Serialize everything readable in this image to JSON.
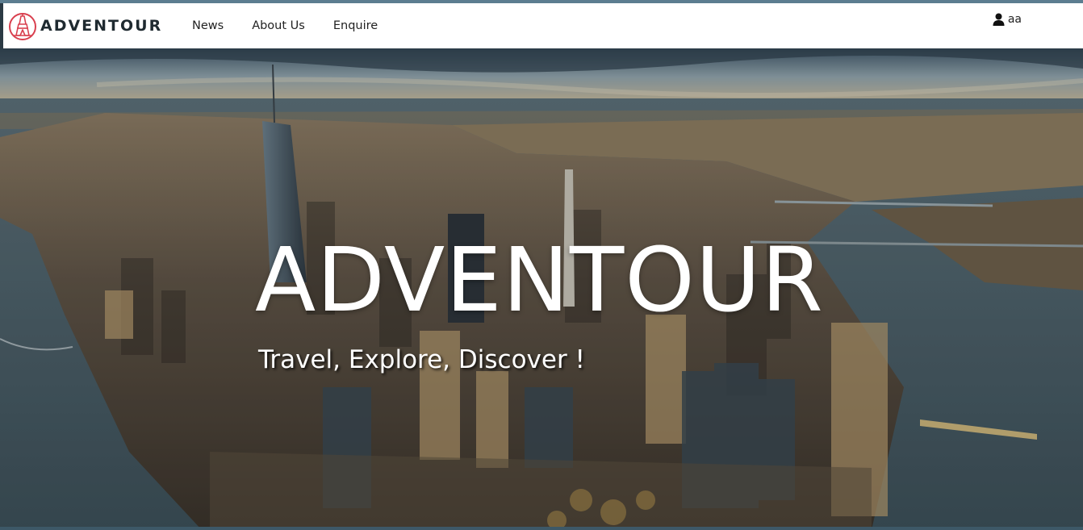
{
  "brand": {
    "name": "ADVENTOUR",
    "accent": "#d9404f"
  },
  "nav": {
    "items": [
      {
        "label": "News"
      },
      {
        "label": "About Us"
      },
      {
        "label": "Enquire"
      }
    ]
  },
  "user": {
    "icon": "user-icon",
    "name": "aa"
  },
  "hero": {
    "title": "ADVENTOUR",
    "subtitle": "Travel, Explore, Discover !"
  }
}
